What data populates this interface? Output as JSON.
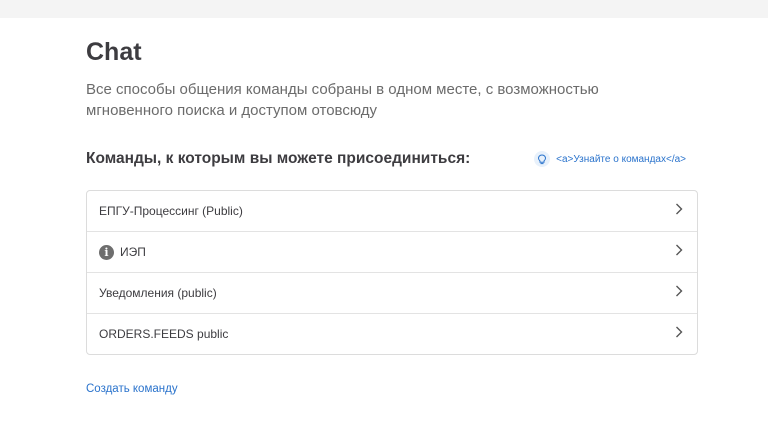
{
  "page": {
    "title": "Chat",
    "subtitle": "Все способы общения команды собраны в одном месте, с возможностью мгновенного поиска и доступом отовсюду"
  },
  "teams": {
    "heading": "Команды, к которым вы можете присоединиться:",
    "learn_link": "<a>Узнайте о командах</a>",
    "items": [
      {
        "label": "ЕПГУ-Процессинг (Public)"
      },
      {
        "label": "ИЭП",
        "icon": "info-icon"
      },
      {
        "label": "Уведомления (public)"
      },
      {
        "label": "ORDERS.FEEDS public"
      }
    ]
  },
  "actions": {
    "create_team": "Создать команду"
  },
  "colors": {
    "link": "#2a73cc",
    "text": "#3d3c40",
    "muted": "#6b6b6b"
  }
}
